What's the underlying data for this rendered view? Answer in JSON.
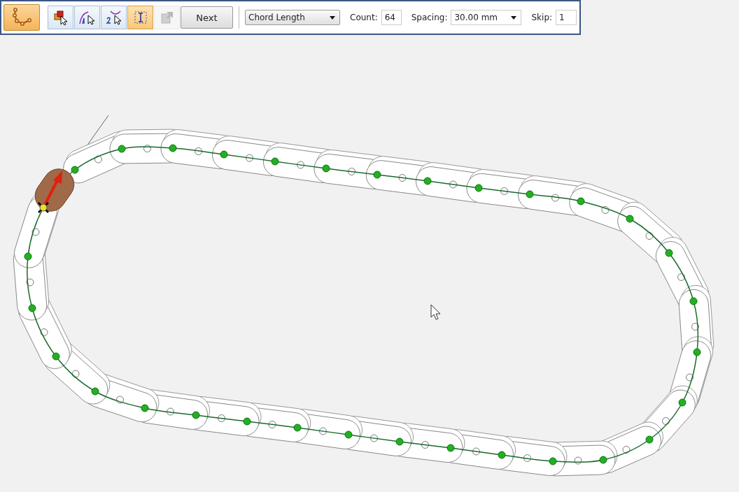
{
  "command_button": {
    "selected": true
  },
  "tool_buttons": [
    {
      "kind": "select-part",
      "selected": false,
      "disabled": false
    },
    {
      "kind": "first-curve",
      "selected": false,
      "disabled": false
    },
    {
      "kind": "second-curve",
      "selected": false,
      "disabled": false
    },
    {
      "kind": "extent",
      "selected": true,
      "disabled": false
    },
    {
      "kind": "reposition",
      "selected": false,
      "disabled": true
    }
  ],
  "next_button": {
    "label": "Next"
  },
  "step_type": {
    "value": "Chord Length"
  },
  "count": {
    "label": "Count:",
    "value": "64"
  },
  "spacing": {
    "label": "Spacing:",
    "value": "30.00 mm"
  },
  "skip": {
    "label": "Skip:",
    "value": "1"
  }
}
